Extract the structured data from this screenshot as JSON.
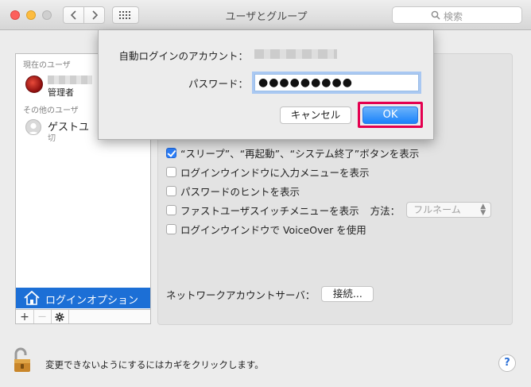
{
  "window": {
    "title": "ユーザとグループ"
  },
  "toolbar": {
    "search_placeholder": "検索"
  },
  "sidebar": {
    "current_users_header": "現在のユーザ",
    "admin_user": {
      "role": "管理者"
    },
    "other_users_header": "その他のユーザ",
    "guest_user": {
      "name": "ゲストユ",
      "status": "切"
    },
    "login_options_label": "ログインオプション",
    "buttons": {
      "add": "+",
      "remove": "—"
    }
  },
  "options": [
    {
      "label": "“スリープ”、“再起動”、“システム終了”ボタンを表示",
      "checked": true
    },
    {
      "label": "ログインウインドウに入力メニューを表示",
      "checked": false
    },
    {
      "label": "パスワードのヒントを表示",
      "checked": false
    },
    {
      "label": "ファストユーザスイッチメニューを表示",
      "checked": false
    },
    {
      "label": "ログインウインドウで VoiceOver を使用",
      "checked": false
    }
  ],
  "fast_user_switch": {
    "method_label": "方法：",
    "method_value": "フルネーム"
  },
  "network": {
    "label": "ネットワークアカウントサーバ：",
    "button": "接続..."
  },
  "lock": {
    "text": "変更できないようにするにはカギをクリックします。"
  },
  "help": {
    "label": "?"
  },
  "dialog": {
    "account_label": "自動ログインのアカウント：",
    "password_label": "パスワード：",
    "password_value": "●●●●●●●●●",
    "cancel_label": "キャンセル",
    "ok_label": "OK"
  },
  "colors": {
    "accent": "#1c6fd6",
    "highlight": "#e4004f"
  }
}
